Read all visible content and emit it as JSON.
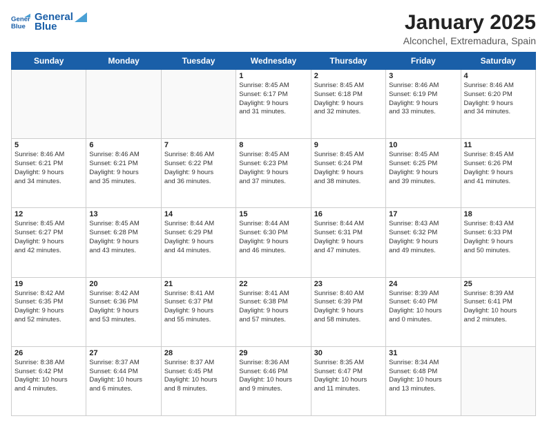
{
  "logo": {
    "line1": "General",
    "line2": "Blue"
  },
  "title": "January 2025",
  "subtitle": "Alconchel, Extremadura, Spain",
  "weekdays": [
    "Sunday",
    "Monday",
    "Tuesday",
    "Wednesday",
    "Thursday",
    "Friday",
    "Saturday"
  ],
  "weeks": [
    [
      {
        "day": "",
        "info": ""
      },
      {
        "day": "",
        "info": ""
      },
      {
        "day": "",
        "info": ""
      },
      {
        "day": "1",
        "info": "Sunrise: 8:45 AM\nSunset: 6:17 PM\nDaylight: 9 hours\nand 31 minutes."
      },
      {
        "day": "2",
        "info": "Sunrise: 8:45 AM\nSunset: 6:18 PM\nDaylight: 9 hours\nand 32 minutes."
      },
      {
        "day": "3",
        "info": "Sunrise: 8:46 AM\nSunset: 6:19 PM\nDaylight: 9 hours\nand 33 minutes."
      },
      {
        "day": "4",
        "info": "Sunrise: 8:46 AM\nSunset: 6:20 PM\nDaylight: 9 hours\nand 34 minutes."
      }
    ],
    [
      {
        "day": "5",
        "info": "Sunrise: 8:46 AM\nSunset: 6:21 PM\nDaylight: 9 hours\nand 34 minutes."
      },
      {
        "day": "6",
        "info": "Sunrise: 8:46 AM\nSunset: 6:21 PM\nDaylight: 9 hours\nand 35 minutes."
      },
      {
        "day": "7",
        "info": "Sunrise: 8:46 AM\nSunset: 6:22 PM\nDaylight: 9 hours\nand 36 minutes."
      },
      {
        "day": "8",
        "info": "Sunrise: 8:45 AM\nSunset: 6:23 PM\nDaylight: 9 hours\nand 37 minutes."
      },
      {
        "day": "9",
        "info": "Sunrise: 8:45 AM\nSunset: 6:24 PM\nDaylight: 9 hours\nand 38 minutes."
      },
      {
        "day": "10",
        "info": "Sunrise: 8:45 AM\nSunset: 6:25 PM\nDaylight: 9 hours\nand 39 minutes."
      },
      {
        "day": "11",
        "info": "Sunrise: 8:45 AM\nSunset: 6:26 PM\nDaylight: 9 hours\nand 41 minutes."
      }
    ],
    [
      {
        "day": "12",
        "info": "Sunrise: 8:45 AM\nSunset: 6:27 PM\nDaylight: 9 hours\nand 42 minutes."
      },
      {
        "day": "13",
        "info": "Sunrise: 8:45 AM\nSunset: 6:28 PM\nDaylight: 9 hours\nand 43 minutes."
      },
      {
        "day": "14",
        "info": "Sunrise: 8:44 AM\nSunset: 6:29 PM\nDaylight: 9 hours\nand 44 minutes."
      },
      {
        "day": "15",
        "info": "Sunrise: 8:44 AM\nSunset: 6:30 PM\nDaylight: 9 hours\nand 46 minutes."
      },
      {
        "day": "16",
        "info": "Sunrise: 8:44 AM\nSunset: 6:31 PM\nDaylight: 9 hours\nand 47 minutes."
      },
      {
        "day": "17",
        "info": "Sunrise: 8:43 AM\nSunset: 6:32 PM\nDaylight: 9 hours\nand 49 minutes."
      },
      {
        "day": "18",
        "info": "Sunrise: 8:43 AM\nSunset: 6:33 PM\nDaylight: 9 hours\nand 50 minutes."
      }
    ],
    [
      {
        "day": "19",
        "info": "Sunrise: 8:42 AM\nSunset: 6:35 PM\nDaylight: 9 hours\nand 52 minutes."
      },
      {
        "day": "20",
        "info": "Sunrise: 8:42 AM\nSunset: 6:36 PM\nDaylight: 9 hours\nand 53 minutes."
      },
      {
        "day": "21",
        "info": "Sunrise: 8:41 AM\nSunset: 6:37 PM\nDaylight: 9 hours\nand 55 minutes."
      },
      {
        "day": "22",
        "info": "Sunrise: 8:41 AM\nSunset: 6:38 PM\nDaylight: 9 hours\nand 57 minutes."
      },
      {
        "day": "23",
        "info": "Sunrise: 8:40 AM\nSunset: 6:39 PM\nDaylight: 9 hours\nand 58 minutes."
      },
      {
        "day": "24",
        "info": "Sunrise: 8:39 AM\nSunset: 6:40 PM\nDaylight: 10 hours\nand 0 minutes."
      },
      {
        "day": "25",
        "info": "Sunrise: 8:39 AM\nSunset: 6:41 PM\nDaylight: 10 hours\nand 2 minutes."
      }
    ],
    [
      {
        "day": "26",
        "info": "Sunrise: 8:38 AM\nSunset: 6:42 PM\nDaylight: 10 hours\nand 4 minutes."
      },
      {
        "day": "27",
        "info": "Sunrise: 8:37 AM\nSunset: 6:44 PM\nDaylight: 10 hours\nand 6 minutes."
      },
      {
        "day": "28",
        "info": "Sunrise: 8:37 AM\nSunset: 6:45 PM\nDaylight: 10 hours\nand 8 minutes."
      },
      {
        "day": "29",
        "info": "Sunrise: 8:36 AM\nSunset: 6:46 PM\nDaylight: 10 hours\nand 9 minutes."
      },
      {
        "day": "30",
        "info": "Sunrise: 8:35 AM\nSunset: 6:47 PM\nDaylight: 10 hours\nand 11 minutes."
      },
      {
        "day": "31",
        "info": "Sunrise: 8:34 AM\nSunset: 6:48 PM\nDaylight: 10 hours\nand 13 minutes."
      },
      {
        "day": "",
        "info": ""
      }
    ]
  ]
}
